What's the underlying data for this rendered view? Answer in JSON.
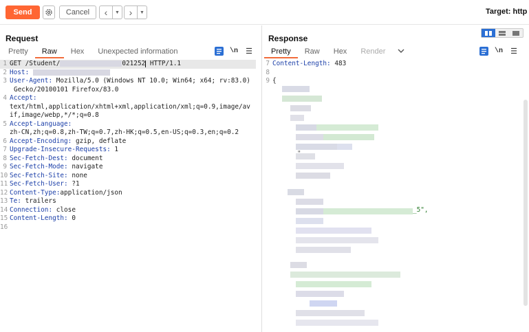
{
  "toolbar": {
    "send_label": "Send",
    "cancel_label": "Cancel",
    "target_label": "Target: http"
  },
  "request": {
    "title": "Request",
    "tabs": [
      "Pretty",
      "Raw",
      "Hex",
      "Unexpected information"
    ],
    "active_tab": "Raw",
    "lines": {
      "l1_method": "GET /Student/",
      "l1_path_tail": "021252",
      "l1_proto": "HTTP/1.1",
      "l2_key": "Host:",
      "l3_key": "User-Agent:",
      "l3_val": " Mozilla/5.0 (Windows NT 10.0; Win64; x64; rv:83.0)",
      "l3_cont": "Gecko/20100101 Firefox/83.0",
      "l4_key": "Accept:",
      "l4_cont1": "text/html,application/xhtml+xml,application/xml;q=0.9,image/av",
      "l4_cont2": "if,image/webp,*/*;q=0.8",
      "l5_key": "Accept-Language:",
      "l5_cont": "zh-CN,zh;q=0.8,zh-TW;q=0.7,zh-HK;q=0.5,en-US;q=0.3,en;q=0.2",
      "l6_key": "Accept-Encoding:",
      "l6_val": " gzip, deflate",
      "l7_key": "Upgrade-Insecure-Requests:",
      "l7_val": " 1",
      "l8_key": "Sec-Fetch-Dest:",
      "l8_val": " document",
      "l9_key": "Sec-Fetch-Mode:",
      "l9_val": " navigate",
      "l10_key": "Sec-Fetch-Site:",
      "l10_val": " none",
      "l11_key": "Sec-Fetch-User:",
      "l11_val": " ?1",
      "l12_key": "Content-Type:",
      "l12_val": "application/json",
      "l13_key": "Te:",
      "l13_val": " trailers",
      "l14_key": "Connection:",
      "l14_val": " close",
      "l15_key": "Content-Length:",
      "l15_val": " 0"
    },
    "line_numbers": [
      "1",
      "2",
      "3",
      "",
      "4",
      "",
      "",
      "5",
      "",
      "6",
      "7",
      "8",
      "9",
      "10",
      "11",
      "12",
      "13",
      "14",
      "15",
      "16"
    ]
  },
  "response": {
    "title": "Response",
    "tabs": [
      "Pretty",
      "Raw",
      "Hex",
      "Render"
    ],
    "active_tab": "Pretty",
    "line7_key": "Content-Length:",
    "line7_val": " 483",
    "line9": "{",
    "visible_fragment": "_5\",",
    "quote_mark": "\"",
    "line_numbers": [
      "7",
      "8",
      "9"
    ]
  },
  "icons": {
    "settings": "gear-icon",
    "back": "chevron-left-icon",
    "forward": "chevron-right-icon",
    "pretty_toggle": "format-icon",
    "newline": "newline-icon",
    "menu": "hamburger-icon"
  },
  "colors": {
    "accent": "#ff6633",
    "header_key": "#1a3ea8",
    "active_tab_underline": "#f26b3a",
    "layout_toggle_active": "#2b6fd4"
  }
}
